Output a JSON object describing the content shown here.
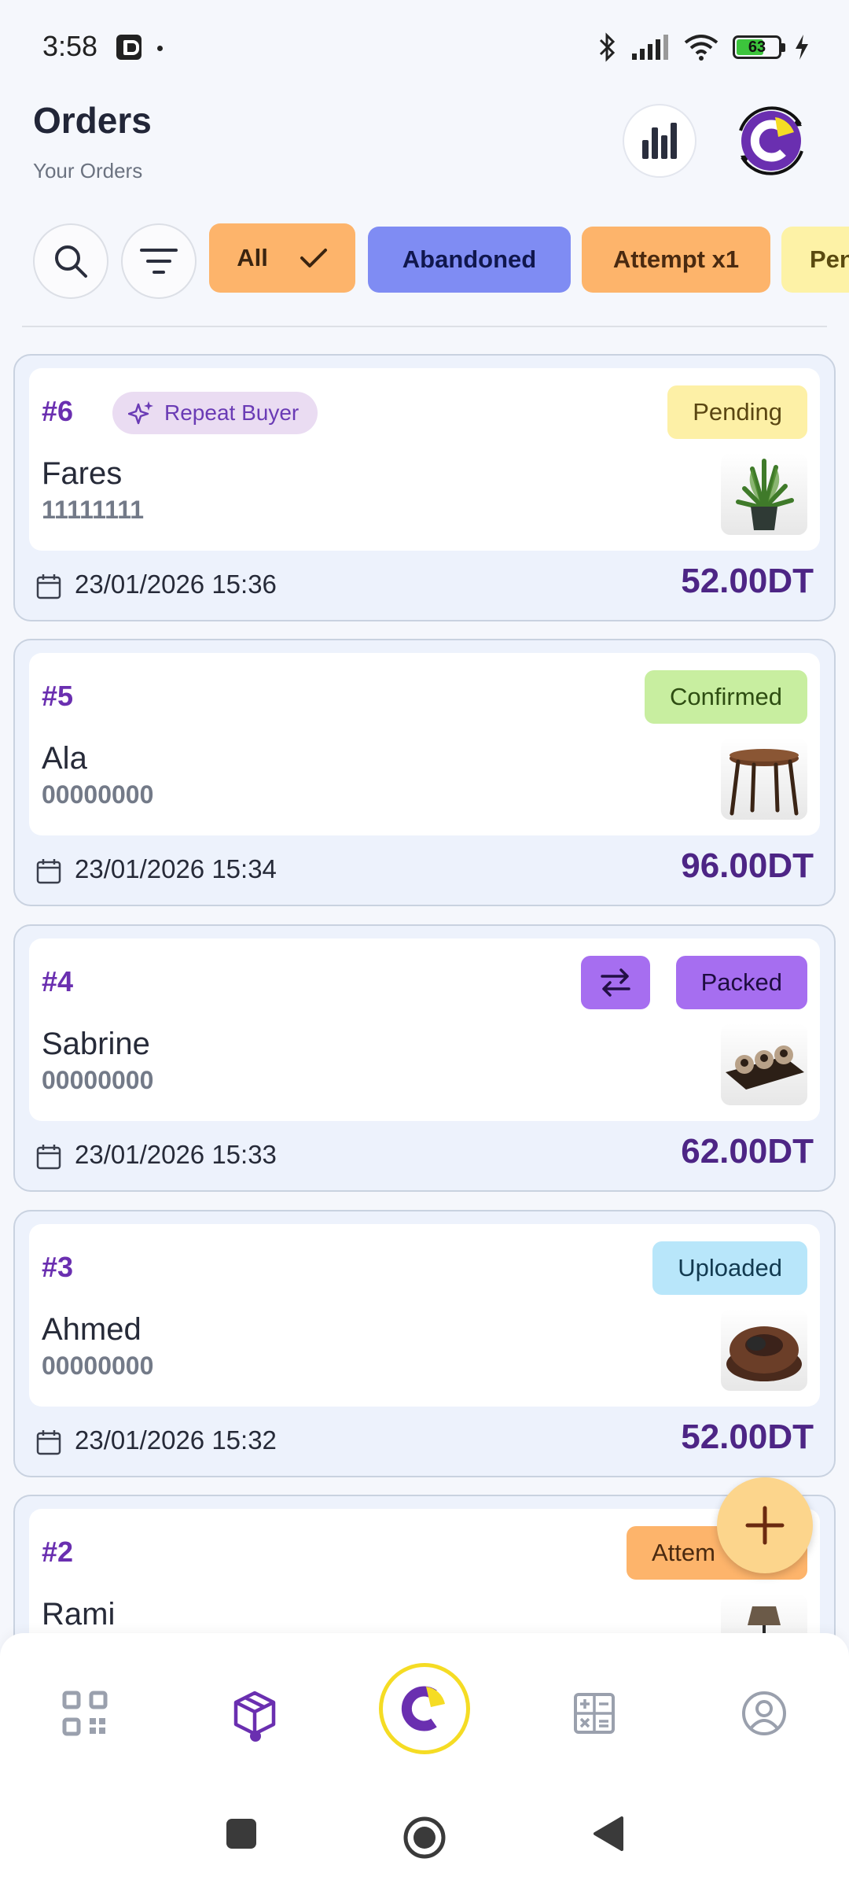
{
  "status_bar": {
    "time": "3:58",
    "battery": "63"
  },
  "header": {
    "title": "Orders",
    "subtitle": "Your Orders"
  },
  "filters": {
    "chips": [
      {
        "label": "All",
        "selected": true,
        "color": "#fdb46b"
      },
      {
        "label": "Abandoned",
        "color": "#7f8cf3"
      },
      {
        "label": "Attempt x1",
        "color": "#fdb46b"
      },
      {
        "label": "Pen",
        "color": "#fdf2a6"
      }
    ]
  },
  "orders": [
    {
      "id": "#6",
      "badge": "Repeat Buyer",
      "status": "Pending",
      "status_color": "#fdf0a6",
      "name": "Fares",
      "phone": "11111111",
      "date": "23/01/2026 15:36",
      "total": "52.00DT",
      "product_icon": "plant-image"
    },
    {
      "id": "#5",
      "status": "Confirmed",
      "status_color": "#c8eea0",
      "name": "Ala",
      "phone": "00000000",
      "date": "23/01/2026 15:34",
      "total": "96.00DT",
      "product_icon": "side-table-image"
    },
    {
      "id": "#4",
      "status": "Packed",
      "status_color": "#a66ef0",
      "name": "Sabrine",
      "phone": "00000000",
      "date": "23/01/2026 15:33",
      "total": "62.00DT",
      "product_icon": "candle-holder-image"
    },
    {
      "id": "#3",
      "status": "Uploaded",
      "status_color": "#b8e6fa",
      "name": "Ahmed",
      "phone": "00000000",
      "date": "23/01/2026 15:32",
      "total": "52.00DT",
      "product_icon": "bean-bag-image"
    },
    {
      "id": "#2",
      "status": "Attem",
      "status_color": "#fdb46b",
      "name": "Rami",
      "product_icon": "lamp-image"
    }
  ],
  "bottom_nav": {
    "items": [
      "qr-code-icon",
      "box-icon",
      "home-logo",
      "calculator-icon",
      "profile-icon"
    ],
    "active": "box-icon"
  },
  "colors": {
    "brand_purple": "#6a2fb0",
    "brand_yellow": "#f5dc24",
    "total_purple": "#4d2585"
  }
}
